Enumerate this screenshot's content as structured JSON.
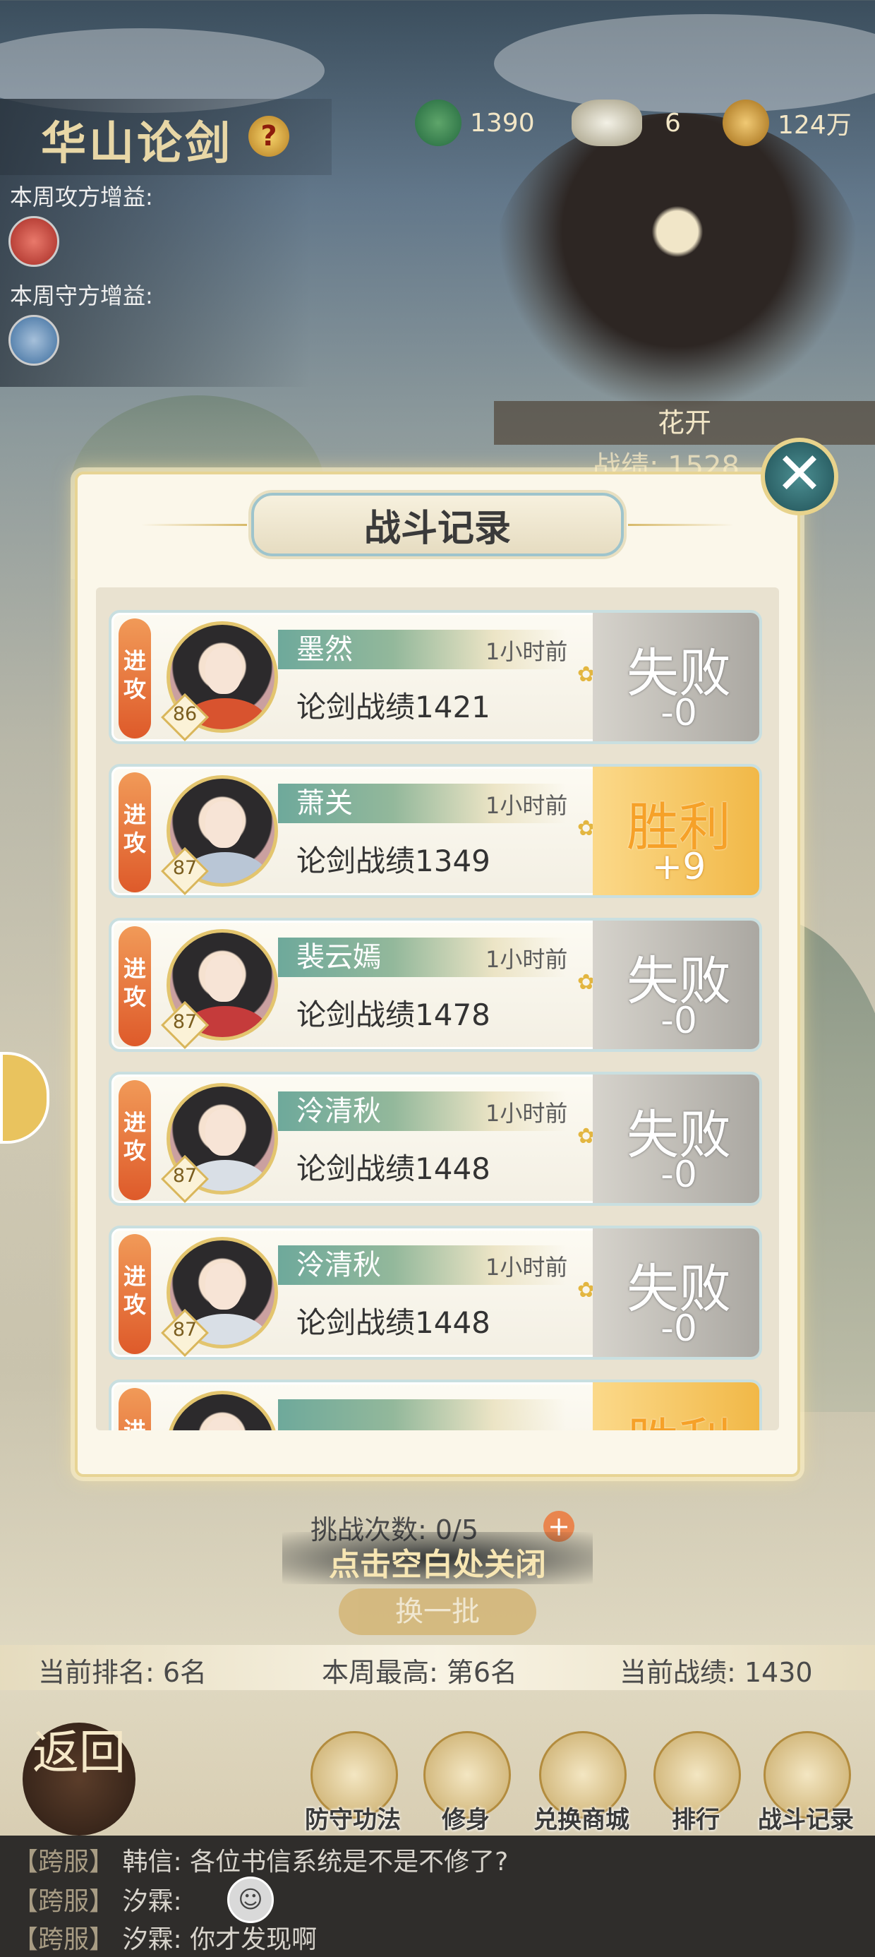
{
  "top_resources": [
    {
      "icon": "jade-dragon-icon",
      "value": "1390"
    },
    {
      "icon": "silver-ingot-icon",
      "value": "6"
    },
    {
      "icon": "gold-coin-icon",
      "value": "124万"
    }
  ],
  "header": {
    "title": "华山论剑",
    "help": "?"
  },
  "buffs": {
    "attack_label": "本周攻方增益:",
    "defense_label": "本周守方增益:"
  },
  "boss": {
    "name": "花开",
    "score": "战绩: 1528"
  },
  "modal": {
    "title": "战斗记录",
    "close": "✕",
    "records": [
      {
        "tag": "进攻",
        "level": "86",
        "name": "墨然",
        "time": "1小时前",
        "score": "论剑战绩1421",
        "result": "失败",
        "delta": "-0",
        "outcome": "lose",
        "robe": "#d8532f"
      },
      {
        "tag": "进攻",
        "level": "87",
        "name": "萧关",
        "time": "1小时前",
        "score": "论剑战绩1349",
        "result": "胜利",
        "delta": "+9",
        "outcome": "win",
        "robe": "#b9c6d6"
      },
      {
        "tag": "进攻",
        "level": "87",
        "name": "裴云嫣",
        "time": "1小时前",
        "score": "论剑战绩1478",
        "result": "失败",
        "delta": "-0",
        "outcome": "lose",
        "robe": "#c53b3b"
      },
      {
        "tag": "进攻",
        "level": "87",
        "name": "泠清秋",
        "time": "1小时前",
        "score": "论剑战绩1448",
        "result": "失败",
        "delta": "-0",
        "outcome": "lose",
        "robe": "#d9dfe6"
      },
      {
        "tag": "进攻",
        "level": "87",
        "name": "泠清秋",
        "time": "1小时前",
        "score": "论剑战绩1448",
        "result": "失败",
        "delta": "-0",
        "outcome": "lose",
        "robe": "#d9dfe6"
      },
      {
        "tag": "进攻",
        "level": "",
        "name": "",
        "time": "",
        "score": "",
        "result": "胜利",
        "delta": "",
        "outcome": "win",
        "robe": "#d9dfe6"
      }
    ]
  },
  "challenge": {
    "label": "挑战次数: 0/5",
    "plus": "+"
  },
  "tap_close": "点击空白处关闭",
  "refresh": "换一批",
  "stats": {
    "rank": "当前排名: 6名",
    "weekly_best": "本周最高: 第6名",
    "current_score": "当前战绩: 1430"
  },
  "return_label": "返回",
  "nav": [
    "防守功法",
    "修身",
    "兑换商城",
    "排行",
    "战斗记录"
  ],
  "chat": [
    {
      "tag": "【跨服】",
      "sender": "韩信:",
      "text": "各位书信系统是不是不修了?"
    },
    {
      "tag": "【跨服】",
      "sender": "汐霖:",
      "text": ""
    },
    {
      "tag": "【跨服】",
      "sender": "汐霖:",
      "text": "你才发现啊"
    }
  ]
}
